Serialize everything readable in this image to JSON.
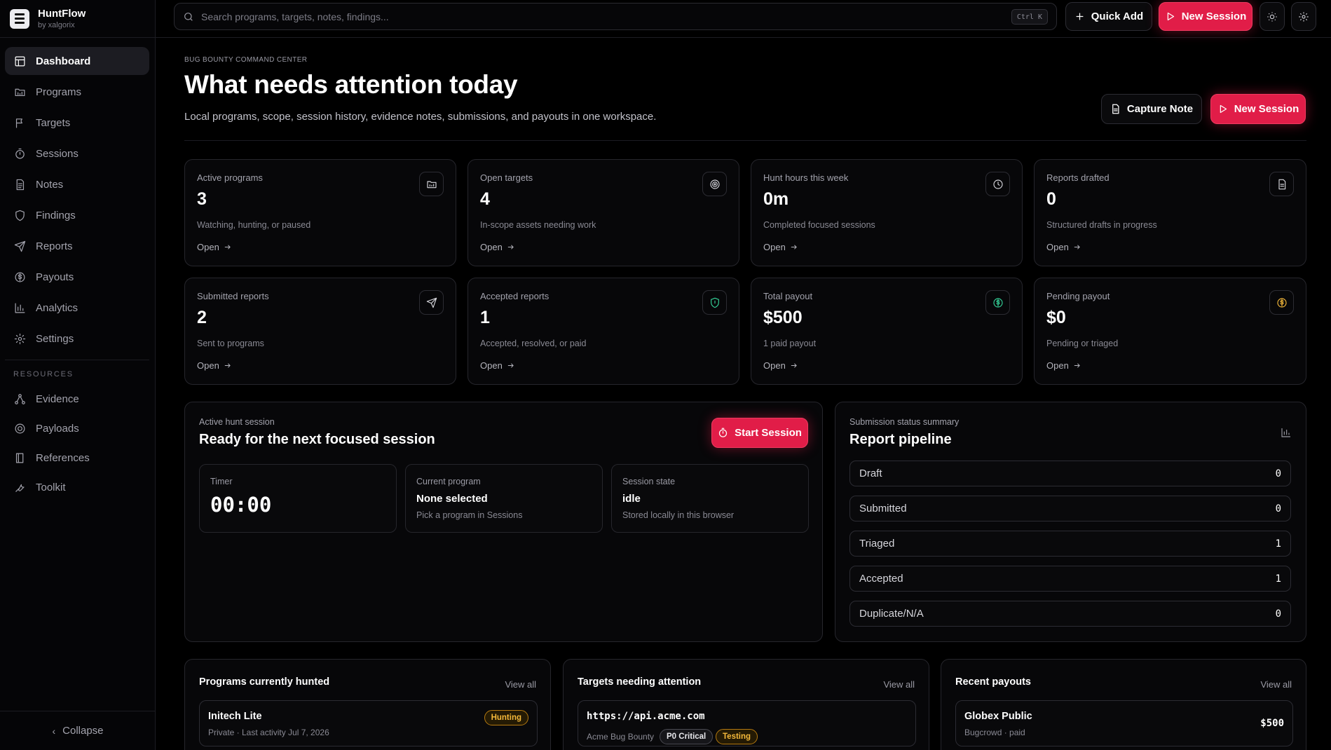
{
  "app": {
    "name": "HuntFlow",
    "byline": "by xalgorix"
  },
  "sidebar": {
    "items": [
      {
        "label": "Dashboard",
        "icon": "dashboard-icon",
        "active": true
      },
      {
        "label": "Programs",
        "icon": "folder-icon"
      },
      {
        "label": "Targets",
        "icon": "flag-icon"
      },
      {
        "label": "Sessions",
        "icon": "timer-icon"
      },
      {
        "label": "Notes",
        "icon": "note-icon"
      },
      {
        "label": "Findings",
        "icon": "shield-icon"
      },
      {
        "label": "Reports",
        "icon": "send-icon"
      },
      {
        "label": "Payouts",
        "icon": "dollar-icon"
      },
      {
        "label": "Analytics",
        "icon": "bar-chart-icon"
      },
      {
        "label": "Settings",
        "icon": "gear-icon"
      }
    ],
    "resources_label": "RESOURCES",
    "resources": [
      {
        "label": "Evidence",
        "icon": "network-icon"
      },
      {
        "label": "Payloads",
        "icon": "target-icon"
      },
      {
        "label": "References",
        "icon": "book-icon"
      },
      {
        "label": "Toolkit",
        "icon": "wrench-icon"
      }
    ],
    "collapse_label": "Collapse"
  },
  "topbar": {
    "search_placeholder": "Search programs, targets, notes, findings...",
    "shortcut": "Ctrl K",
    "quick_add_label": "Quick Add",
    "new_session_label": "New Session"
  },
  "header": {
    "eyebrow": "Bug bounty command center",
    "title": "What needs attention today",
    "subtitle": "Local programs, scope, session history, evidence notes, submissions, and payouts in one workspace.",
    "capture_note_label": "Capture Note",
    "new_session_label": "New Session"
  },
  "stats": [
    {
      "label": "Active programs",
      "value": "3",
      "desc": "Watching, hunting, or paused",
      "link": "Open",
      "icon": "folder-icon"
    },
    {
      "label": "Open targets",
      "value": "4",
      "desc": "In-scope assets needing work",
      "link": "Open",
      "icon": "target-icon"
    },
    {
      "label": "Hunt hours this week",
      "value": "0m",
      "desc": "Completed focused sessions",
      "link": "Open",
      "icon": "clock-icon"
    },
    {
      "label": "Reports drafted",
      "value": "0",
      "desc": "Structured drafts in progress",
      "link": "Open",
      "icon": "document-icon"
    },
    {
      "label": "Submitted reports",
      "value": "2",
      "desc": "Sent to programs",
      "link": "Open",
      "icon": "send-icon"
    },
    {
      "label": "Accepted reports",
      "value": "1",
      "desc": "Accepted, resolved, or paid",
      "link": "Open",
      "icon": "shield-icon"
    },
    {
      "label": "Total payout",
      "value": "$500",
      "desc": "1 paid payout",
      "link": "Open",
      "icon": "dollar-icon"
    },
    {
      "label": "Pending payout",
      "value": "$0",
      "desc": "Pending or triaged",
      "link": "Open",
      "icon": "dollar-icon"
    }
  ],
  "session": {
    "label": "Active hunt session",
    "title": "Ready for the next focused session",
    "start_label": "Start Session",
    "timer_label": "Timer",
    "timer_value": "00:00",
    "program_label": "Current program",
    "program_value": "None selected",
    "program_desc": "Pick a program in Sessions",
    "state_label": "Session state",
    "state_value": "idle",
    "state_desc": "Stored locally in this browser"
  },
  "pipeline": {
    "label": "Submission status summary",
    "title": "Report pipeline",
    "rows": [
      {
        "label": "Draft",
        "count": "0"
      },
      {
        "label": "Submitted",
        "count": "0"
      },
      {
        "label": "Triaged",
        "count": "1"
      },
      {
        "label": "Accepted",
        "count": "1"
      },
      {
        "label": "Duplicate/N/A",
        "count": "0"
      }
    ]
  },
  "programs": {
    "title": "Programs currently hunted",
    "view_all": "View all",
    "items": [
      {
        "name": "Initech Lite",
        "meta": "Private · Last activity Jul 7, 2026",
        "badge": "Hunting"
      }
    ]
  },
  "targets": {
    "title": "Targets needing attention",
    "view_all": "View all",
    "items": [
      {
        "url": "https://api.acme.com",
        "program": "Acme Bug Bounty",
        "priority": "P0 Critical",
        "status": "Testing"
      }
    ]
  },
  "payouts": {
    "title": "Recent payouts",
    "view_all": "View all",
    "items": [
      {
        "name": "Globex Public",
        "meta": "Bugcrowd · paid",
        "amount": "$500"
      }
    ]
  },
  "colors": {
    "accent": "#e11d48",
    "success": "#34d399",
    "warning": "#f5b93a"
  }
}
